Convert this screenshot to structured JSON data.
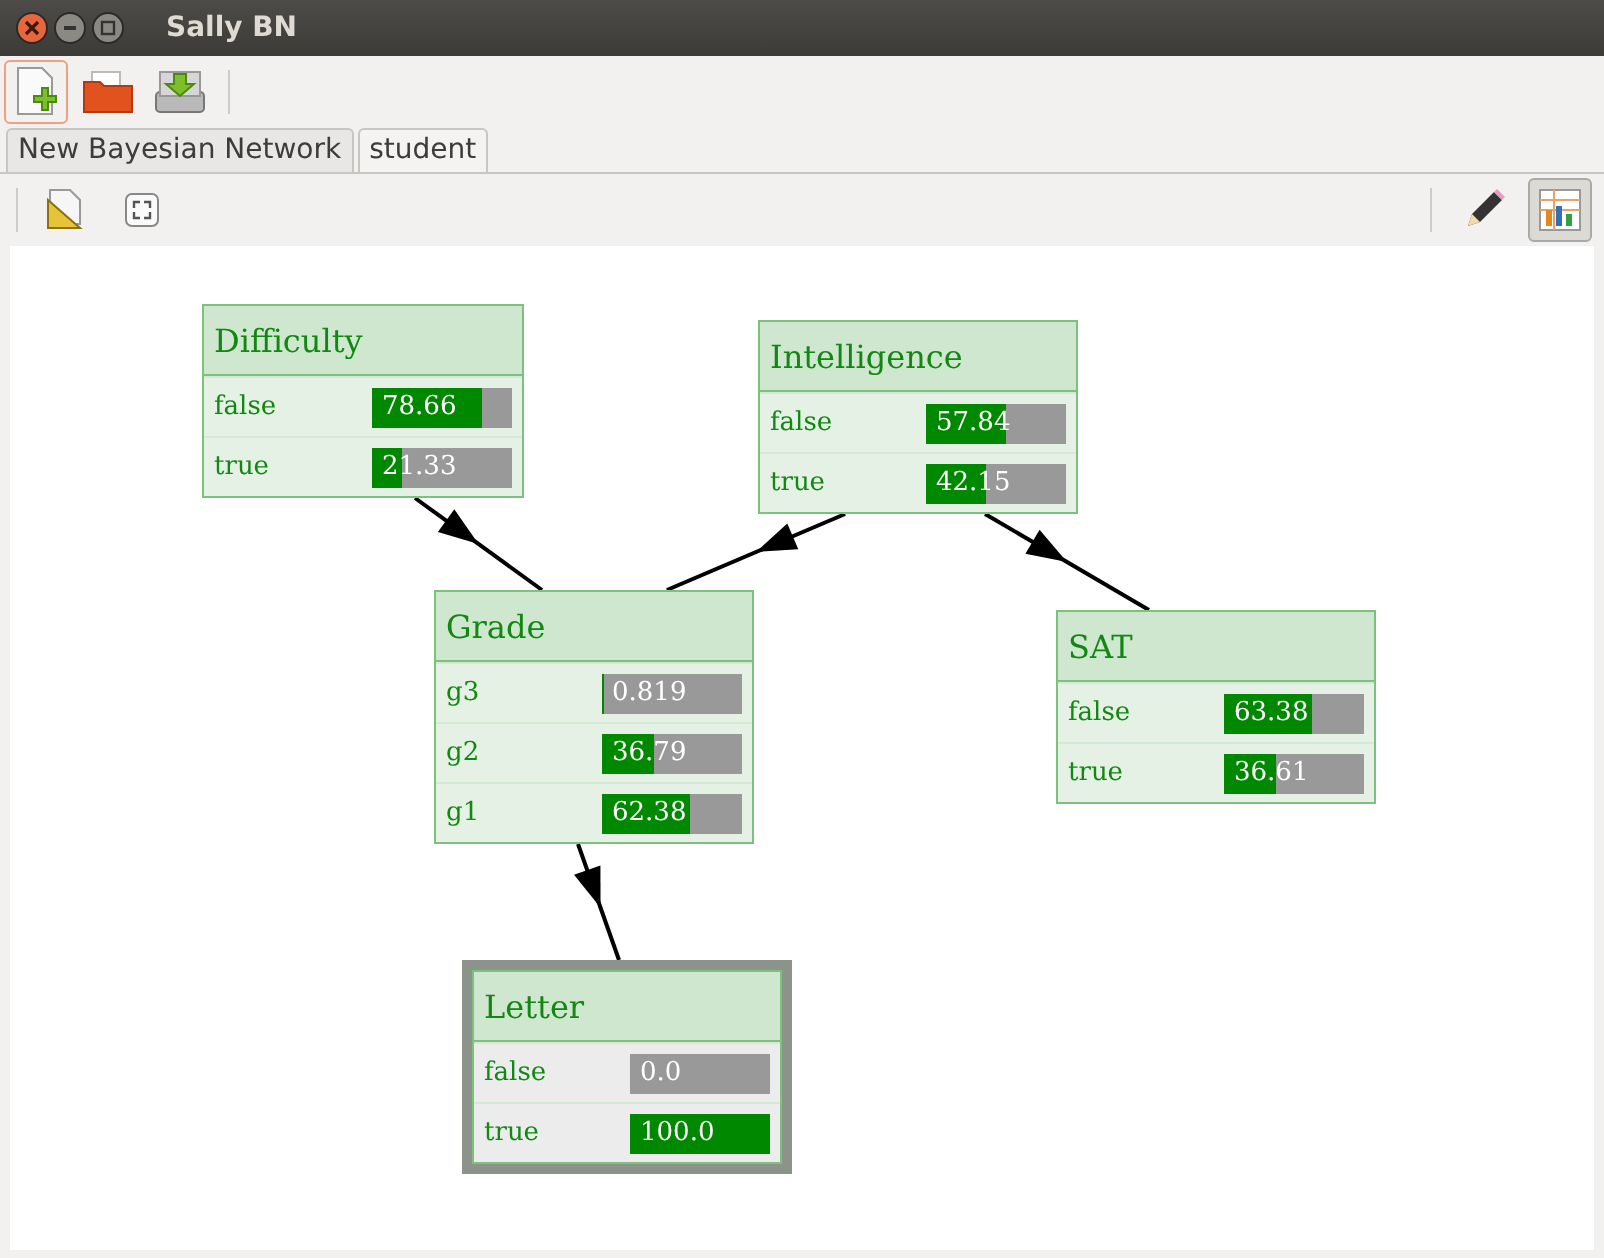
{
  "window": {
    "title": "Sally BN"
  },
  "tabs": [
    {
      "label": "New Bayesian Network",
      "selected": false
    },
    {
      "label": "student",
      "selected": true
    }
  ],
  "nodes": [
    {
      "name": "Difficulty",
      "observed": false,
      "states": [
        {
          "label": "false",
          "value": "78.66",
          "level": 0.7866
        },
        {
          "label": "true",
          "value": "21.33",
          "level": 0.2133
        }
      ]
    },
    {
      "name": "Intelligence",
      "observed": false,
      "states": [
        {
          "label": "false",
          "value": "57.84",
          "level": 0.5784
        },
        {
          "label": "true",
          "value": "42.15",
          "level": 0.4215
        }
      ]
    },
    {
      "name": "Grade",
      "observed": false,
      "states": [
        {
          "label": "g3",
          "value": "0.819",
          "level": 0.00819
        },
        {
          "label": "g2",
          "value": "36.79",
          "level": 0.3679
        },
        {
          "label": "g1",
          "value": "62.38",
          "level": 0.6238
        }
      ]
    },
    {
      "name": "SAT",
      "observed": false,
      "states": [
        {
          "label": "false",
          "value": "63.38",
          "level": 0.6338
        },
        {
          "label": "true",
          "value": "36.61",
          "level": 0.3661
        }
      ]
    },
    {
      "name": "Letter",
      "observed": true,
      "states": [
        {
          "label": "false",
          "value": "0.0",
          "level": 0
        },
        {
          "label": "true",
          "value": "100.0",
          "level": 1
        }
      ]
    }
  ],
  "view_toggle": {
    "pressed": true
  }
}
